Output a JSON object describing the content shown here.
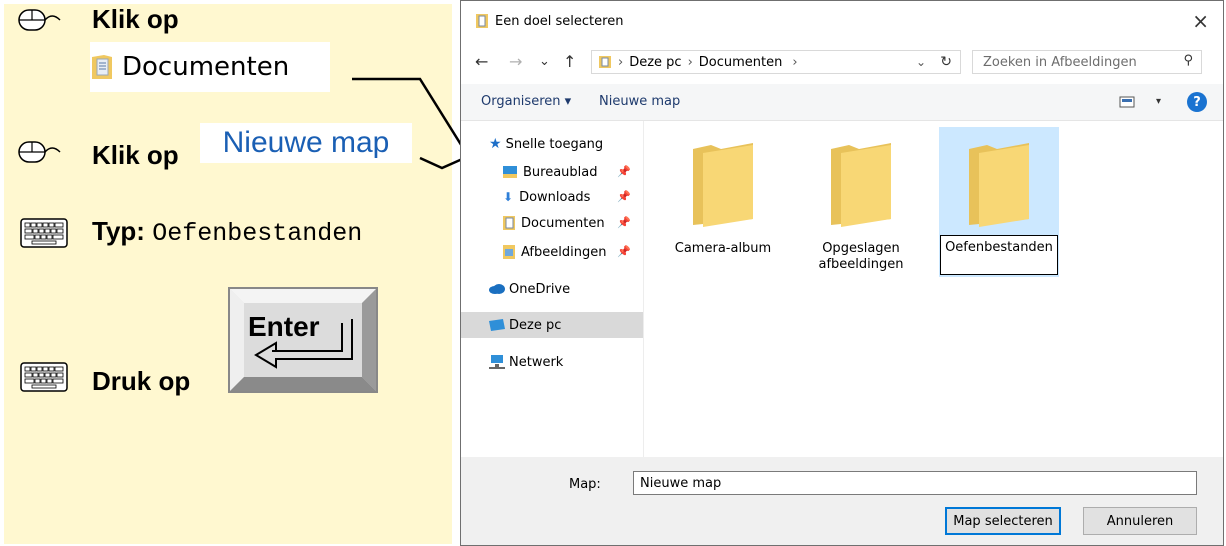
{
  "instructions": {
    "step1": {
      "label": "Klik op",
      "target": "Documenten",
      "icon": "mouse-icon"
    },
    "step2": {
      "label": "Klik op",
      "target": "Nieuwe map",
      "icon": "mouse-icon"
    },
    "step3": {
      "label": "Typ:",
      "value": "Oefenbestanden",
      "icon": "keyboard-icon"
    },
    "step4": {
      "label": "Druk op",
      "key": "Enter",
      "icon": "keyboard-icon"
    }
  },
  "dialog": {
    "title": "Een doel selecteren",
    "close": "×",
    "nav": {
      "back": "←",
      "forward": "→",
      "recent": "⌄",
      "up": "↑"
    },
    "breadcrumb": [
      "Deze pc",
      "Documenten"
    ],
    "search_placeholder": "Zoeken in Afbeeldingen",
    "toolbar": {
      "organize": "Organiseren",
      "new_folder": "Nieuwe map",
      "help": "?"
    },
    "sidebar": [
      {
        "label": "Snelle toegang",
        "icon": "star-icon"
      },
      {
        "label": "Bureaublad",
        "icon": "desktop-icon",
        "pinned": true
      },
      {
        "label": "Downloads",
        "icon": "download-icon",
        "pinned": true
      },
      {
        "label": "Documenten",
        "icon": "document-icon",
        "pinned": true
      },
      {
        "label": "Afbeeldingen",
        "icon": "picture-icon",
        "pinned": true
      },
      {
        "label": "OneDrive",
        "icon": "cloud-icon"
      },
      {
        "label": "Deze pc",
        "icon": "computer-icon",
        "selected": true
      },
      {
        "label": "Netwerk",
        "icon": "network-icon"
      }
    ],
    "folders": [
      {
        "line1": "Camera-album",
        "line2": ""
      },
      {
        "line1": "Opgeslagen",
        "line2": "afbeeldingen"
      },
      {
        "line1": "Oefenbestanden",
        "line2": "",
        "selected": true
      }
    ],
    "footer": {
      "map_label": "Map:",
      "map_value": "Nieuwe map",
      "select_button": "Map selecteren",
      "cancel_button": "Annuleren"
    }
  },
  "colors": {
    "panel": "#fff8d0",
    "selection": "#cce8ff",
    "accent": "#0078d7",
    "folder": "#f8d775"
  }
}
